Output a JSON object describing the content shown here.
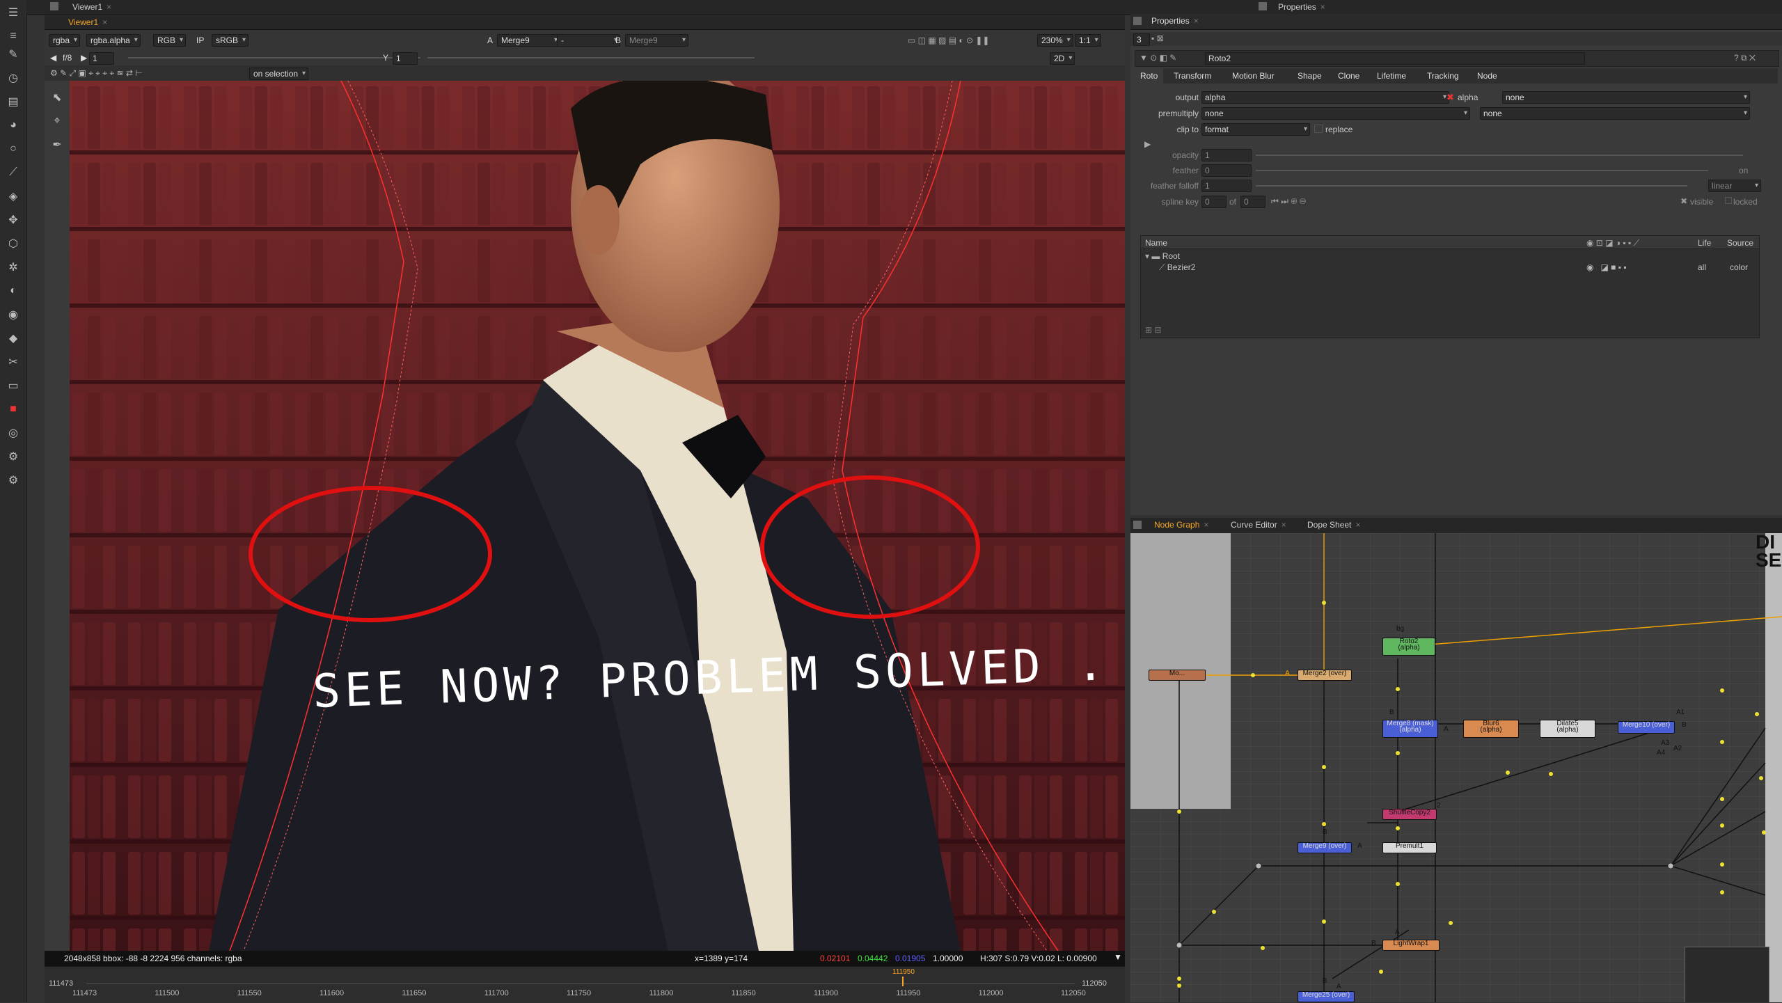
{
  "app": {
    "viewer_tab": "Viewer1",
    "viewer_subtab": "Viewer1",
    "properties_tab_top": "Properties",
    "properties_tab": "Properties"
  },
  "viewer": {
    "channels": "rgba",
    "layer": "rgba.alpha",
    "mode": "RGB",
    "ip": "IP",
    "lut": "sRGB",
    "input_a_label": "A",
    "input_a": "Merge9",
    "dash": "-",
    "input_b_label": "B",
    "input_b": "Merge9",
    "zoom": "230%",
    "ratio": "1:1",
    "fstop": "f/8",
    "frame": "1",
    "y_label": "Y",
    "y_value": "1",
    "view_mode": "2D",
    "on_selection": "on selection",
    "handwritten_note": "SEE NOW? PROBLEM SOLVED .",
    "status_format": "2048x858  bbox: -88 -8 2224 956 channels: rgba",
    "status_coords": "x=1389 y=174",
    "status_r": "0.02101",
    "status_g": "0.04442",
    "status_b": "0.01905",
    "status_a": "1.00000",
    "status_hsv": "H:307 S:0.79 V:0.02  L: 0.00900"
  },
  "timeline": {
    "start": "111473",
    "end": "112050",
    "current": "111950",
    "ticks": [
      "111473",
      "111500",
      "111550",
      "111600",
      "111650",
      "111700",
      "111750",
      "111800",
      "111850",
      "111900",
      "111950",
      "112000",
      "112050"
    ]
  },
  "properties": {
    "count": "3",
    "node_name": "Roto2",
    "tabs": [
      "Roto",
      "Transform",
      "Motion Blur",
      "Shape",
      "Clone",
      "Lifetime",
      "Tracking",
      "Node"
    ],
    "output_label": "output",
    "output_value": "alpha",
    "alpha_check_label": "alpha",
    "output_right": "none",
    "premultiply_label": "premultiply",
    "premultiply_value": "none",
    "premultiply_right": "none",
    "clip_to_label": "clip to",
    "clip_to_value": "format",
    "replace_label": "replace",
    "opacity_label": "opacity",
    "opacity_value": "1",
    "feather_label": "feather",
    "feather_value": "0",
    "feather_falloff_label": "feather falloff",
    "feather_falloff_value": "1",
    "falloff_type": "linear",
    "spline_key_label": "spline key",
    "spline_key_value": "0",
    "of_label": "of",
    "of_value": "0",
    "visible_label": "visible",
    "locked_label": "locked",
    "on_label": "on",
    "tree_headers": {
      "name": "Name",
      "life": "Life",
      "source": "Source"
    },
    "tree_root": "Root",
    "tree_shape": "Bezier2",
    "tree_life": "all",
    "tree_source": "color"
  },
  "node_graph": {
    "tabs": [
      "Node Graph",
      "Curve Editor",
      "Dope Sheet"
    ],
    "backdrop_label": "DI SE",
    "nodes": {
      "roto2": "Roto2",
      "roto2_sub": "(alpha)",
      "bg": "bg",
      "merge2": "Merge2 (over)",
      "merge8": "Merge8 (mask)",
      "merge8_sub": "(alpha)",
      "blur6": "Blur6",
      "blur6_sub": "(alpha)",
      "dilate5": "Dilate5",
      "dilate5_sub": "(alpha)",
      "merge10": "Merge10 (over)",
      "shuffle": "ShuffleCopy2",
      "merge9": "Merge9 (over)",
      "premult": "Premult1",
      "lightwrap": "LightWrap1",
      "merge25": "Merge25 (over)",
      "left_node": "Mo..."
    },
    "pin_labels": {
      "a": "A",
      "b": "B",
      "a1": "A1",
      "a2": "A2",
      "a3": "A3",
      "a4": "A4",
      "two": "2"
    }
  },
  "colors": {
    "accent": "#f5a623",
    "roto_node": "#5fb85f",
    "merge_node": "#4a5ed6",
    "blur_node": "#d98a50",
    "dilate_node": "#d8d8d8",
    "shuffle_node": "#c23a6f",
    "red_annotation": "#e01010"
  }
}
